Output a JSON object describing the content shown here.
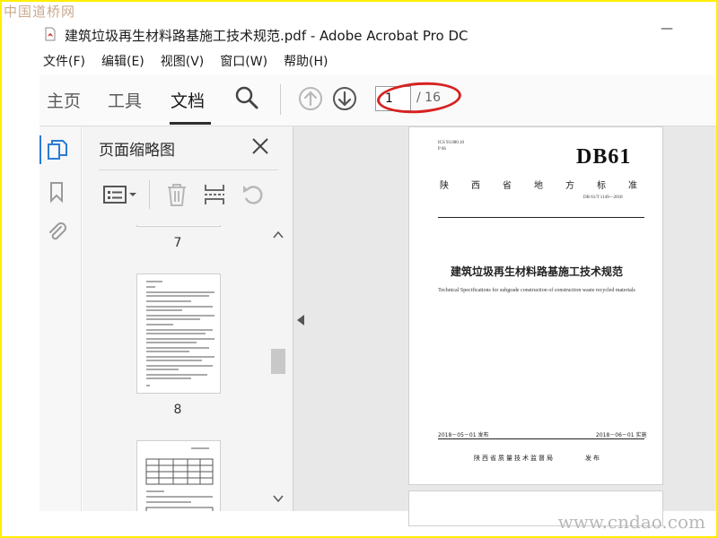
{
  "watermark": {
    "top": "中国道桥网",
    "bottom": "www.cndao.com"
  },
  "window": {
    "title": "建筑垃圾再生材料路基施工技术规范.pdf - Adobe Acrobat Pro DC",
    "icon": "pdf-file-icon",
    "minimize": "—"
  },
  "menu": {
    "file": "文件(F)",
    "edit": "编辑(E)",
    "view": "视图(V)",
    "window": "窗口(W)",
    "help": "帮助(H)"
  },
  "toolbar": {
    "home": "主页",
    "tools": "工具",
    "document": "文档",
    "search_icon": "search-icon",
    "prev_icon": "arrow-up-circle-icon",
    "next_icon": "arrow-down-circle-icon",
    "current_page": "1",
    "page_total": "/ 16",
    "highlight_color": "#d62222"
  },
  "sidebar": {
    "icons": [
      "page-thumbnails-icon",
      "bookmark-icon",
      "attachment-icon"
    ],
    "accent": "#2a7bd6"
  },
  "thumbnails": {
    "title": "页面缩略图",
    "tools": [
      "thumbnail-options-icon",
      "delete-page-icon",
      "insert-page-icon",
      "rotate-icon"
    ],
    "labels": [
      "7",
      "8"
    ]
  },
  "document": {
    "ics": "ICS 93.080.10",
    "classification": "P 66",
    "code": "DB61",
    "province_chars": [
      "陕",
      "西",
      "省",
      "地",
      "方",
      "标",
      "准"
    ],
    "std_number": "DB 61/T 1149—2018",
    "title_cn": "建筑垃圾再生材料路基施工技术规范",
    "title_en": "Technical Specifications for subgrade construction of construction waste recycled materials",
    "issue_date": "2018－05－01 发布",
    "effective_date": "2018－06－01 实施",
    "issuer": "陕西省质量技术监督局",
    "publish": "发布"
  }
}
